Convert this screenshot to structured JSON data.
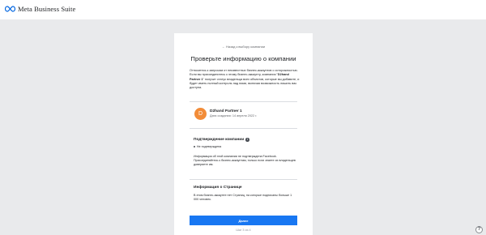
{
  "app": {
    "title": "Meta Business Suite"
  },
  "back_link": "← Назад к выбору компании",
  "title": "Проверьте информацию о компании",
  "intro": {
    "part1": "Относитесь к запросам от неизвестных бизнес-аккаунтов с осторожностью. Если вы присоединитесь к этому бизнес-аккаунту, компания \"",
    "company": "D2hand Partner 1",
    "part2": "\" получит статус владельца всех объектов, которые вы добавите, и будет иметь полный контроль над ними, включая возможность лишить вас доступа."
  },
  "company": {
    "initial": "D",
    "name": "D2hand Partner 1",
    "created": "Дата создания: 14 апреля 2022 г."
  },
  "verification": {
    "title": "Подтверждение компании",
    "status": "Не подтверждена",
    "description": "Информация об этой компании не подтверждена Facebook. Присоединяйтесь к бизнес-аккаунтам, только если знаете их владельцев доверяете им."
  },
  "pages_info": {
    "title": "Информация о Странице",
    "description": "В этом бизнес-аккаунте нет Страниц, на которые подписаны больше 1 000 человек."
  },
  "done_button": "Далее",
  "step": "Шаг 3 из 4",
  "colors": {
    "brand": "#1877f2",
    "avatar": "#f28c38",
    "background": "#e9eaec"
  },
  "icons": {
    "logo": "meta-infinity-icon",
    "info": "info-icon",
    "help": "help-icon"
  }
}
